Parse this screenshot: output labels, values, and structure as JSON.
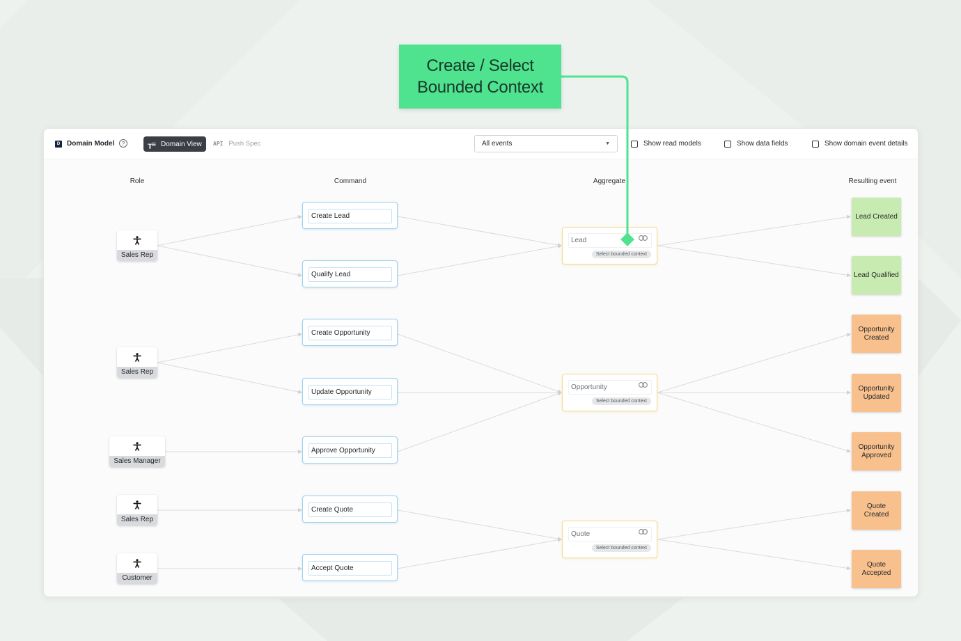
{
  "callout": {
    "line1": "Create / Select",
    "line2": "Bounded Context",
    "color": "#4fe28f"
  },
  "toolbar": {
    "logo_letter": "D",
    "title": "Domain Model",
    "help_glyph": "?",
    "domain_view_label": "Domain View",
    "push_spec_icon": "API",
    "push_spec_label": "Push Spec",
    "event_filter": {
      "selected": "All events"
    },
    "checkboxes": [
      {
        "label": "Show read models",
        "checked": false
      },
      {
        "label": "Show data fields",
        "checked": false
      },
      {
        "label": "Show domain event details",
        "checked": false
      }
    ]
  },
  "columns": {
    "role": "Role",
    "command": "Command",
    "aggregate": "Aggregate",
    "resulting_event": "Resulting event"
  },
  "roles": [
    {
      "label": "Sales Rep",
      "icon": "person-icon"
    },
    {
      "label": "Sales Rep",
      "icon": "person-icon"
    },
    {
      "label": "Sales Manager",
      "icon": "person-icon"
    },
    {
      "label": "Sales Rep",
      "icon": "person-icon"
    },
    {
      "label": "Customer",
      "icon": "person-icon"
    }
  ],
  "commands": [
    {
      "label": "Create Lead"
    },
    {
      "label": "Qualify Lead"
    },
    {
      "label": "Create Opportunity"
    },
    {
      "label": "Update Opportunity"
    },
    {
      "label": "Approve Opportunity"
    },
    {
      "label": "Create Quote"
    },
    {
      "label": "Accept Quote"
    }
  ],
  "aggregates": [
    {
      "label": "Lead",
      "bounded_context": "Select bounded context",
      "icon": "link-icon"
    },
    {
      "label": "Opportunity",
      "bounded_context": "Select bounded context",
      "icon": "link-icon"
    },
    {
      "label": "Quote",
      "bounded_context": "Select bounded context",
      "icon": "link-icon"
    }
  ],
  "events": [
    {
      "label": "Lead Created",
      "color": "#c7ebb0"
    },
    {
      "label": "Lead Qualified",
      "color": "#c7ebb0"
    },
    {
      "label": "Opportunity Created",
      "color": "#f7c08d"
    },
    {
      "label": "Opportunity Updated",
      "color": "#f7c08d"
    },
    {
      "label": "Opportunity Approved",
      "color": "#f7c08d"
    },
    {
      "label": "Quote Created",
      "color": "#f7c08d"
    },
    {
      "label": "Quote Accepted",
      "color": "#f7c08d"
    }
  ]
}
